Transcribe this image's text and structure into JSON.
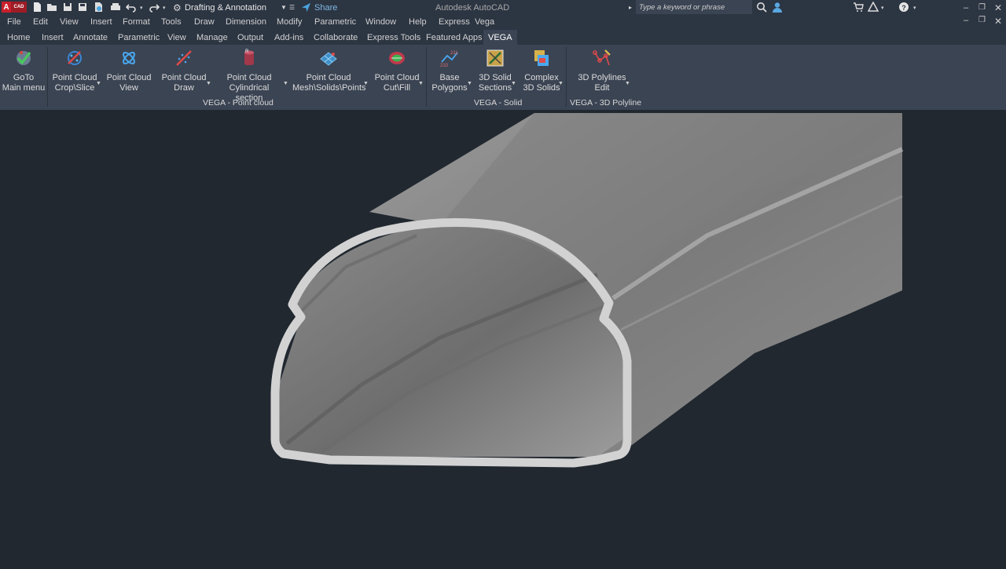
{
  "app": {
    "logo_text": "A",
    "logo_sub": "CAD",
    "workspace": "Drafting & Annotation",
    "share_label": "Share",
    "window_title": "Autodesk AutoCAD",
    "search_placeholder": "Type a keyword or phrase"
  },
  "menu": [
    "File",
    "Edit",
    "View",
    "Insert",
    "Format",
    "Tools",
    "Draw",
    "Dimension",
    "Modify",
    "Parametric",
    "Window",
    "Help",
    "Express",
    "Vega"
  ],
  "tabs": [
    "Home",
    "Insert",
    "Annotate",
    "Parametric",
    "View",
    "Manage",
    "Output",
    "Add-ins",
    "Collaborate",
    "Express Tools",
    "Featured Apps",
    "VEGA"
  ],
  "ribbon": {
    "buttons": [
      {
        "l1": "GoTo",
        "l2": "Main menu",
        "icon": "goto-main-menu-icon"
      },
      {
        "l1": "Point Cloud",
        "l2": "Crop\\Slice",
        "icon": "point-cloud-crop-icon"
      },
      {
        "l1": "Point Cloud",
        "l2": "View",
        "icon": "point-cloud-view-icon"
      },
      {
        "l1": "Point Cloud",
        "l2": "Draw",
        "icon": "point-cloud-draw-icon"
      },
      {
        "l1": "Point Cloud",
        "l2": "Cylindrical section",
        "icon": "point-cloud-cylindrical-icon"
      },
      {
        "l1": "Point Cloud",
        "l2": "Mesh\\Solids\\Points",
        "icon": "point-cloud-mesh-icon"
      },
      {
        "l1": "Point Cloud",
        "l2": "Cut\\Fill",
        "icon": "point-cloud-cutfill-icon"
      },
      {
        "l1": "Base",
        "l2": "Polygons",
        "icon": "base-polygons-icon"
      },
      {
        "l1": "3D Solid",
        "l2": "Sections",
        "icon": "solid-sections-icon"
      },
      {
        "l1": "Complex",
        "l2": "3D Solids",
        "icon": "complex-solids-icon"
      },
      {
        "l1": "3D Polylines",
        "l2": "Edit",
        "icon": "polylines-edit-icon"
      }
    ],
    "panels": [
      "VEGA - Point cloud",
      "VEGA - Solid",
      "VEGA - 3D Polyline"
    ]
  }
}
